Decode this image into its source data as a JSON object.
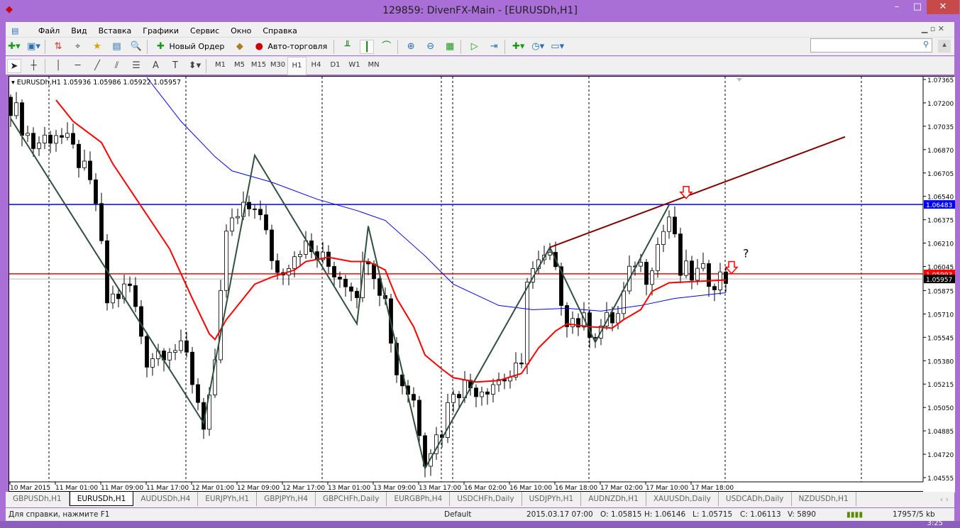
{
  "window": {
    "title": "129859: DivenFX-Main - [EURUSDh,H1]",
    "minimize": "–",
    "maximize": "□",
    "close": "✕"
  },
  "menu": [
    "Файл",
    "Вид",
    "Вставка",
    "Графики",
    "Сервис",
    "Окно",
    "Справка"
  ],
  "toolbar": {
    "new_order": "Новый Ордер",
    "auto_trading": "Авто-торговля"
  },
  "timeframes": [
    "M1",
    "M5",
    "M15",
    "M30",
    "H1",
    "H4",
    "D1",
    "W1",
    "MN"
  ],
  "active_timeframe": "H1",
  "chart": {
    "header": "EURUSDh,H1  1.05936 1.05986 1.05922 1.05957",
    "price_labels": [
      "1.07365",
      "1.07200",
      "1.07035",
      "1.06870",
      "1.06705",
      "1.06540",
      "1.06375",
      "1.06210",
      "1.06045",
      "1.05875",
      "1.05710",
      "1.05545",
      "1.05380",
      "1.05215",
      "1.05050",
      "1.04885",
      "1.04720",
      "1.04555"
    ],
    "blue_level": "1.06483",
    "red_level": "1.05993",
    "bid": "1.05957",
    "time_labels": [
      "10 Mar 2015",
      "11 Mar 01:00",
      "11 Mar 09:00",
      "11 Mar 17:00",
      "12 Mar 01:00",
      "12 Mar 09:00",
      "12 Mar 17:00",
      "13 Mar 01:00",
      "13 Mar 09:00",
      "13 Mar 17:00",
      "16 Mar 02:00",
      "16 Mar 10:00",
      "16 Mar 18:00",
      "17 Mar 02:00",
      "17 Mar 10:00",
      "17 Mar 18:00"
    ],
    "annotation": "?"
  },
  "chart_data": {
    "type": "candlestick",
    "ylim": [
      1.04555,
      1.07365
    ],
    "bars": 127,
    "close_path": [
      [
        0,
        1.072
      ],
      [
        4,
        1.069
      ],
      [
        8,
        1.07
      ],
      [
        12,
        1.068
      ],
      [
        15,
        1.065
      ],
      [
        17,
        1.058
      ],
      [
        21,
        1.059
      ],
      [
        24,
        1.054
      ],
      [
        28,
        1.055
      ],
      [
        31,
        1.054
      ],
      [
        34,
        1.0495
      ],
      [
        36,
        1.053
      ],
      [
        38,
        1.063
      ],
      [
        43,
        1.065
      ],
      [
        47,
        1.06
      ],
      [
        51,
        1.062
      ],
      [
        56,
        1.0605
      ],
      [
        61,
        1.059
      ],
      [
        63,
        1.0615
      ],
      [
        66,
        1.058
      ],
      [
        68,
        1.053
      ],
      [
        71,
        1.051
      ],
      [
        73,
        1.0472
      ],
      [
        76,
        1.049
      ],
      [
        78,
        1.052
      ],
      [
        83,
        1.052
      ],
      [
        86,
        1.0525
      ],
      [
        90,
        1.053
      ],
      [
        91,
        1.06
      ],
      [
        95,
        1.061
      ],
      [
        98,
        1.057
      ],
      [
        103,
        1.056
      ],
      [
        107,
        1.057
      ],
      [
        110,
        1.061
      ],
      [
        112,
        1.06
      ],
      [
        116,
        1.064
      ],
      [
        118,
        1.06
      ],
      [
        126,
        1.0596
      ]
    ],
    "ma_red": [
      [
        8,
        1.0722
      ],
      [
        11,
        1.0707
      ],
      [
        16,
        1.0692
      ],
      [
        18,
        1.0677
      ],
      [
        23,
        1.0647
      ],
      [
        28,
        1.0617
      ],
      [
        32,
        1.0582
      ],
      [
        35,
        1.0557
      ],
      [
        36,
        1.0553
      ],
      [
        38,
        1.0567
      ],
      [
        41,
        1.0582
      ],
      [
        43,
        1.0592
      ],
      [
        46,
        1.0597
      ],
      [
        50,
        1.0602
      ],
      [
        52,
        1.0608
      ],
      [
        56,
        1.0611
      ],
      [
        60,
        1.0608
      ],
      [
        63,
        1.0608
      ],
      [
        66,
        1.0602
      ],
      [
        68,
        1.0582
      ],
      [
        71,
        1.0562
      ],
      [
        73,
        1.0542
      ],
      [
        76,
        1.0532
      ],
      [
        78,
        1.0526
      ],
      [
        82,
        1.0523
      ],
      [
        86,
        1.0524
      ],
      [
        90,
        1.0529
      ],
      [
        93,
        1.0547
      ],
      [
        96,
        1.0559
      ],
      [
        98,
        1.0564
      ],
      [
        102,
        1.0562
      ],
      [
        106,
        1.0561
      ],
      [
        108,
        1.0567
      ],
      [
        111,
        1.0574
      ],
      [
        113,
        1.0587
      ],
      [
        116,
        1.0593
      ],
      [
        121,
        1.0594
      ],
      [
        126,
        1.0595
      ]
    ],
    "ma_blue": [
      [
        24,
        1.0738
      ],
      [
        30,
        1.0707
      ],
      [
        36,
        1.0682
      ],
      [
        39,
        1.0672
      ],
      [
        46,
        1.0664
      ],
      [
        54,
        1.0652
      ],
      [
        61,
        1.0644
      ],
      [
        66,
        1.0637
      ],
      [
        73,
        1.0612
      ],
      [
        78,
        1.0592
      ],
      [
        86,
        1.0577
      ],
      [
        92,
        1.0574
      ],
      [
        98,
        1.0575
      ],
      [
        104,
        1.0573
      ],
      [
        111,
        1.0577
      ],
      [
        117,
        1.0582
      ],
      [
        126,
        1.0586
      ]
    ],
    "zigzag": [
      [
        0,
        1.0709
      ],
      [
        34,
        1.0494
      ],
      [
        43,
        1.0683
      ],
      [
        61,
        1.0564
      ],
      [
        63,
        1.0633
      ],
      [
        73,
        1.0462
      ],
      [
        95,
        1.0618
      ],
      [
        103,
        1.0551
      ],
      [
        116,
        1.0648
      ]
    ],
    "trendline": [
      [
        95,
        1.0618
      ],
      [
        147,
        1.0696
      ]
    ],
    "hlines": {
      "blue": 1.06483,
      "red": 1.05993,
      "bid": 1.05957
    },
    "arrows": [
      [
        119,
        1.0655
      ],
      [
        127,
        1.0602
      ]
    ]
  },
  "tabs": [
    "GBPUSDh,H1",
    "EURUSDh,H1",
    "AUDUSDh,H4",
    "EURJPYh,H1",
    "GBPJPYh,H4",
    "GBPCHFh,Daily",
    "EURGBPh,H4",
    "USDCHFh,Daily",
    "USDJPYh,H1",
    "AUDNZDh,H1",
    "XAUUSDh,Daily",
    "USDCADh,Daily",
    "NZDUSDh,H1"
  ],
  "active_tab": "EURUSDh,H1",
  "status": {
    "help": "Для справки, нажмите F1",
    "profile": "Default",
    "datetime": "2015.03.17 07:00",
    "open": "O: 1.05815",
    "high": "H: 1.06146",
    "low": "L: 1.05715",
    "close": "C: 1.06113",
    "volume": "V: 5890",
    "traffic": "17957/5 kb"
  },
  "taskbar": {
    "clock": "3:25"
  }
}
